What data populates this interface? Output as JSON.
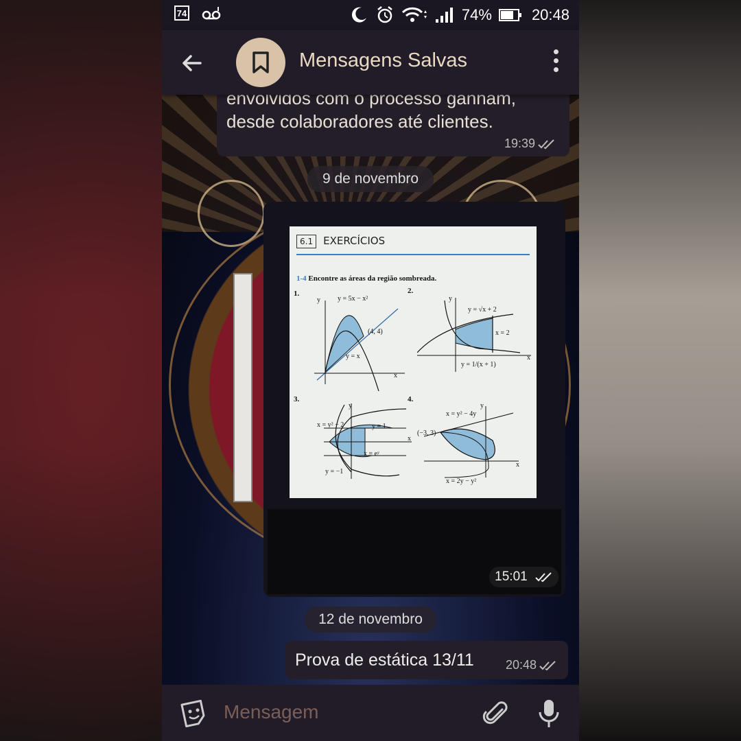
{
  "status_bar": {
    "left_badge": "74",
    "voicemail_icon": "voicemail-icon",
    "battery_percent": "74%",
    "battery_level": 0.74,
    "time": "20:48"
  },
  "app_bar": {
    "title": "Mensagens Salvas",
    "back_icon": "back-arrow-icon",
    "avatar_icon": "bookmark-icon",
    "menu_icon": "more-vert-icon"
  },
  "messages": [
    {
      "text": "envolvidos com o processo ganham, desde colaboradores até clientes.",
      "time": "19:39"
    },
    {
      "date_separator": "9 de novembro",
      "type": "photo",
      "time": "15:01",
      "photo": {
        "section": "6.1",
        "header": "EXERCÍCIOS",
        "range": "1-4",
        "instruction": "Encontre as áreas da região sombreada.",
        "plots": [
          {
            "num": "1.",
            "labels": [
              "y = 5x − x²",
              "(4, 4)",
              "y = x",
              "y",
              "x"
            ]
          },
          {
            "num": "2.",
            "labels": [
              "y = √x + 2",
              "x = 2",
              "y = 1/(x + 1)",
              "y",
              "x"
            ]
          },
          {
            "num": "3.",
            "labels": [
              "x = y² − 2",
              "y = 1",
              "x = eʸ",
              "y = −1",
              "y",
              "x"
            ]
          },
          {
            "num": "4.",
            "labels": [
              "x = y² − 4y",
              "(−3, 3)",
              "x = 2y − y²",
              "y",
              "x"
            ]
          }
        ]
      }
    },
    {
      "date_separator": "12 de novembro",
      "text": "Prova de estática 13/11",
      "time": "20:48"
    }
  ],
  "input": {
    "placeholder": "Mensagem",
    "sticker_icon": "sticker-icon",
    "attach_icon": "paperclip-icon",
    "mic_icon": "microphone-icon"
  },
  "colors": {
    "app_bar": "#221c28",
    "title": "#ead9c3",
    "avatar": "#d8c3a8",
    "placeholder": "#7a5e58",
    "plot_fill": "#8fbcd8"
  }
}
